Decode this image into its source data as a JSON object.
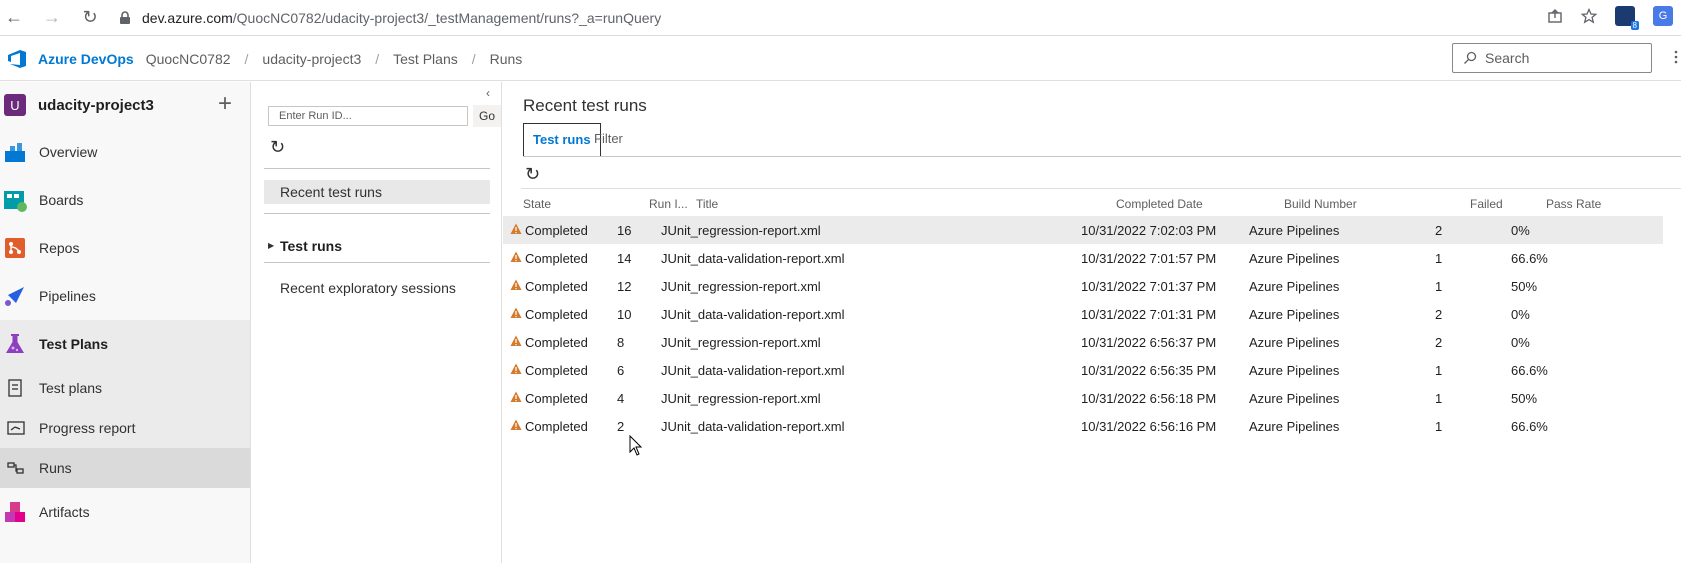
{
  "browser": {
    "url_host": "dev.azure.com",
    "url_path": "/QuocNC0782/udacity-project3/_testManagement/runs?_a=runQuery",
    "extension_badge": "8"
  },
  "header": {
    "brand": "Azure DevOps",
    "breadcrumbs": [
      "QuocNC0782",
      "udacity-project3",
      "Test Plans",
      "Runs"
    ],
    "search_placeholder": "Search"
  },
  "left_nav": {
    "project_initial": "U",
    "project_name": "udacity-project3",
    "items": [
      {
        "label": "Overview"
      },
      {
        "label": "Boards"
      },
      {
        "label": "Repos"
      },
      {
        "label": "Pipelines"
      },
      {
        "label": "Test Plans"
      }
    ],
    "sub_items": [
      {
        "label": "Test plans"
      },
      {
        "label": "Progress report"
      },
      {
        "label": "Runs"
      }
    ],
    "artifacts_label": "Artifacts"
  },
  "mid_panel": {
    "run_id_placeholder": "Enter Run ID...",
    "go_label": "Go",
    "recent_runs": "Recent test runs",
    "test_runs": "Test runs",
    "exploratory": "Recent exploratory sessions"
  },
  "main": {
    "title": "Recent test runs",
    "tabs": [
      "Test runs",
      "Filter"
    ],
    "columns": [
      "State",
      "Run I...",
      "Title",
      "Completed Date",
      "Build Number",
      "Failed",
      "Pass Rate"
    ],
    "rows": [
      {
        "state": "Completed",
        "run_id": "16",
        "title": "JUnit_regression-report.xml",
        "date": "10/31/2022 7:02:03 PM",
        "build": "Azure Pipelines",
        "failed": "2",
        "pass_rate": "0%"
      },
      {
        "state": "Completed",
        "run_id": "14",
        "title": "JUnit_data-validation-report.xml",
        "date": "10/31/2022 7:01:57 PM",
        "build": "Azure Pipelines",
        "failed": "1",
        "pass_rate": "66.6%"
      },
      {
        "state": "Completed",
        "run_id": "12",
        "title": "JUnit_regression-report.xml",
        "date": "10/31/2022 7:01:37 PM",
        "build": "Azure Pipelines",
        "failed": "1",
        "pass_rate": "50%"
      },
      {
        "state": "Completed",
        "run_id": "10",
        "title": "JUnit_data-validation-report.xml",
        "date": "10/31/2022 7:01:31 PM",
        "build": "Azure Pipelines",
        "failed": "2",
        "pass_rate": "0%"
      },
      {
        "state": "Completed",
        "run_id": "8",
        "title": "JUnit_regression-report.xml",
        "date": "10/31/2022 6:56:37 PM",
        "build": "Azure Pipelines",
        "failed": "2",
        "pass_rate": "0%"
      },
      {
        "state": "Completed",
        "run_id": "6",
        "title": "JUnit_data-validation-report.xml",
        "date": "10/31/2022 6:56:35 PM",
        "build": "Azure Pipelines",
        "failed": "1",
        "pass_rate": "66.6%"
      },
      {
        "state": "Completed",
        "run_id": "4",
        "title": "JUnit_regression-report.xml",
        "date": "10/31/2022 6:56:18 PM",
        "build": "Azure Pipelines",
        "failed": "1",
        "pass_rate": "50%"
      },
      {
        "state": "Completed",
        "run_id": "2",
        "title": "JUnit_data-validation-report.xml",
        "date": "10/31/2022 6:56:16 PM",
        "build": "Azure Pipelines",
        "failed": "1",
        "pass_rate": "66.6%"
      }
    ]
  },
  "colors": {
    "accent": "#0078d4",
    "warning": "#d47a2c",
    "project_avatar": "#6b2a7b"
  }
}
